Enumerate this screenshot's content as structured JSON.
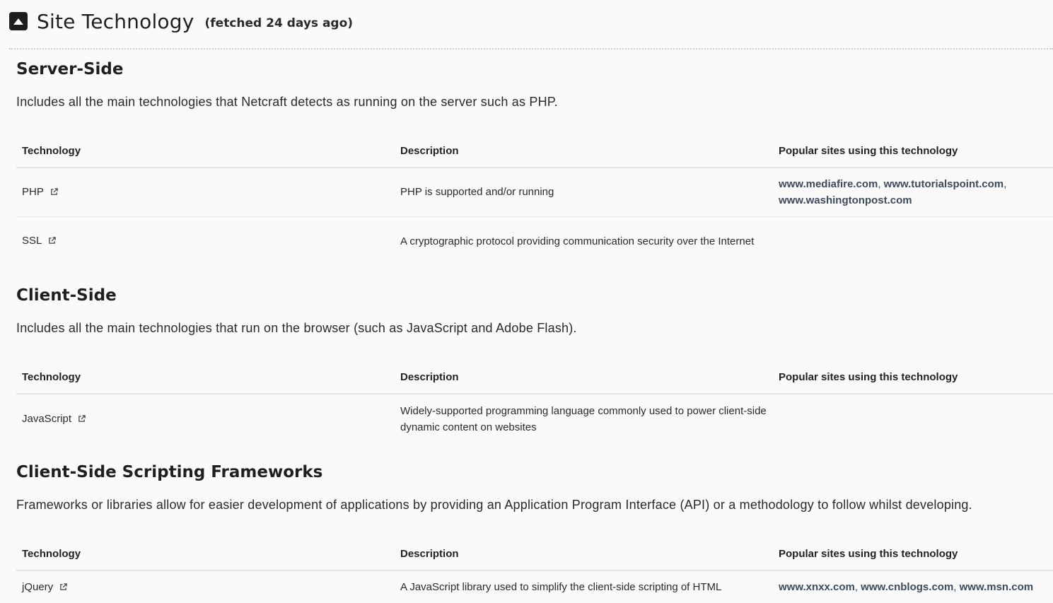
{
  "header": {
    "title": "Site Technology",
    "fetched": "(fetched 24 days ago)"
  },
  "columns": {
    "technology": "Technology",
    "description": "Description",
    "popular": "Popular sites using this technology"
  },
  "sections": [
    {
      "title": "Server-Side",
      "intro": "Includes all the main technologies that Netcraft detects as running on the server such as PHP.",
      "rows": [
        {
          "technology": "PHP",
          "description": "PHP is supported and/or running",
          "sites": [
            "www.mediafire.com",
            "www.tutorialspoint.com",
            "www.washingtonpost.com"
          ]
        },
        {
          "technology": "SSL",
          "description": "A cryptographic protocol providing communication security over the Internet",
          "sites": []
        }
      ]
    },
    {
      "title": "Client-Side",
      "intro": "Includes all the main technologies that run on the browser (such as JavaScript and Adobe Flash).",
      "rows": [
        {
          "technology": "JavaScript",
          "description": "Widely-supported programming language commonly used to power client-side dynamic content on websites",
          "sites": []
        }
      ]
    },
    {
      "title": "Client-Side Scripting Frameworks",
      "intro": "Frameworks or libraries allow for easier development of applications by providing an Application Program Interface (API) or a methodology to follow whilst developing.",
      "rows": [
        {
          "technology": "jQuery",
          "description": "A JavaScript library used to simplify the client-side scripting of HTML",
          "sites": [
            "www.xnxx.com",
            "www.cnblogs.com",
            "www.msn.com"
          ]
        }
      ]
    }
  ]
}
